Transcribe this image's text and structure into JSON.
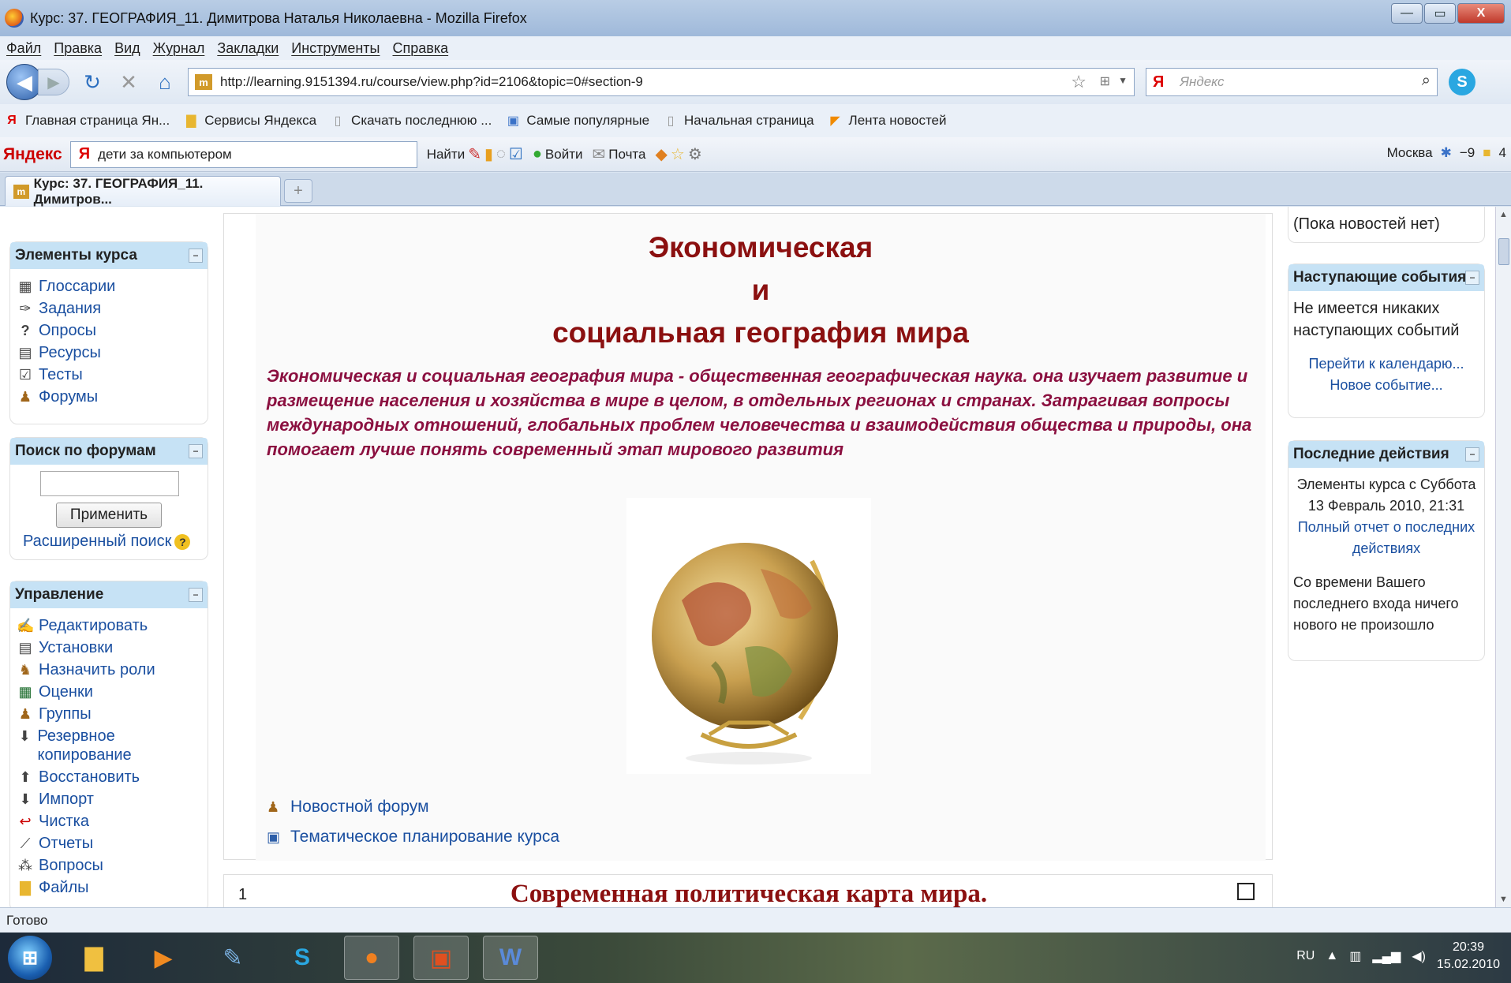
{
  "window": {
    "title": "Курс: 37. ГЕОГРАФИЯ_11. Димитрова Наталья Николаевна - Mozilla Firefox",
    "controls": {
      "minimize": "—",
      "maximize": "▭",
      "close": "X"
    }
  },
  "menu": [
    "Файл",
    "Правка",
    "Вид",
    "Журнал",
    "Закладки",
    "Инструменты",
    "Справка"
  ],
  "nav": {
    "url": "http://learning.9151394.ru/course/view.php?id=2106&topic=0#section-9",
    "search_placeholder": "Яндекс"
  },
  "bookmarks": [
    {
      "label": "Главная страница Ян...",
      "icon": "yandex-icon"
    },
    {
      "label": "Сервисы Яндекса",
      "icon": "folder-icon"
    },
    {
      "label": "Скачать последнюю ...",
      "icon": "page-icon"
    },
    {
      "label": "Самые популярные",
      "icon": "search-icon"
    },
    {
      "label": "Начальная страница",
      "icon": "page-icon"
    },
    {
      "label": "Лента новостей",
      "icon": "rss-icon"
    }
  ],
  "yandex_bar": {
    "logo": "Яндекс",
    "query": "дети за компьютером",
    "find": "Найти",
    "login": "Войти",
    "mail": "Почта",
    "city": "Москва",
    "temp": "−9",
    "extra": "4"
  },
  "tab": {
    "label": "Курс: 37. ГЕОГРАФИЯ_11. Димитров...",
    "new_tab": "+"
  },
  "left": {
    "elements": {
      "title": "Элементы курса",
      "items": [
        "Глоссарии",
        "Задания",
        "Опросы",
        "Ресурсы",
        "Тесты",
        "Форумы"
      ]
    },
    "forum_search": {
      "title": "Поиск по форумам",
      "button": "Применить",
      "advanced": "Расширенный поиск"
    },
    "admin": {
      "title": "Управление",
      "items": [
        "Редактировать",
        "Установки",
        "Назначить роли",
        "Оценки",
        "Группы",
        "Резервное копирование",
        "Восстановить",
        "Импорт",
        "Чистка",
        "Отчеты",
        "Вопросы",
        "Файлы"
      ]
    }
  },
  "main": {
    "heading1": "Экономическая",
    "heading2": "и",
    "heading3": "социальная география мира",
    "description": "Экономическая и социальная география мира - общественная географическая наука. она изучает развитие и размещение населения и хозяйства в мире в целом, в отдельных регионах и странах. Затрагивая вопросы международных отношений, глобальных проблем человечества и взаимодействия общества и природы, она помогает лучше понять современный этап мирового развития",
    "links": [
      "Новостной форум",
      "Тематическое планирование курса"
    ],
    "section1": {
      "number": "1",
      "title": "Современная политическая карта мира."
    }
  },
  "right": {
    "news_empty": "(Пока новостей нет)",
    "events": {
      "title": "Наступающие события",
      "text": "Не имеется никаких наступающих событий",
      "calendar": "Перейти к календарю...",
      "new_event": "Новое событие..."
    },
    "recent": {
      "title": "Последние действия",
      "since": "Элементы курса с Суббота 13 Февраль 2010, 21:31",
      "full_report": "Полный отчет о последних действиях",
      "nothing": "Со времени Вашего последнего входа ничего нового не произошло"
    }
  },
  "status": "Готово",
  "tray": {
    "lang": "RU",
    "time": "20:39",
    "date": "15.02.2010"
  }
}
